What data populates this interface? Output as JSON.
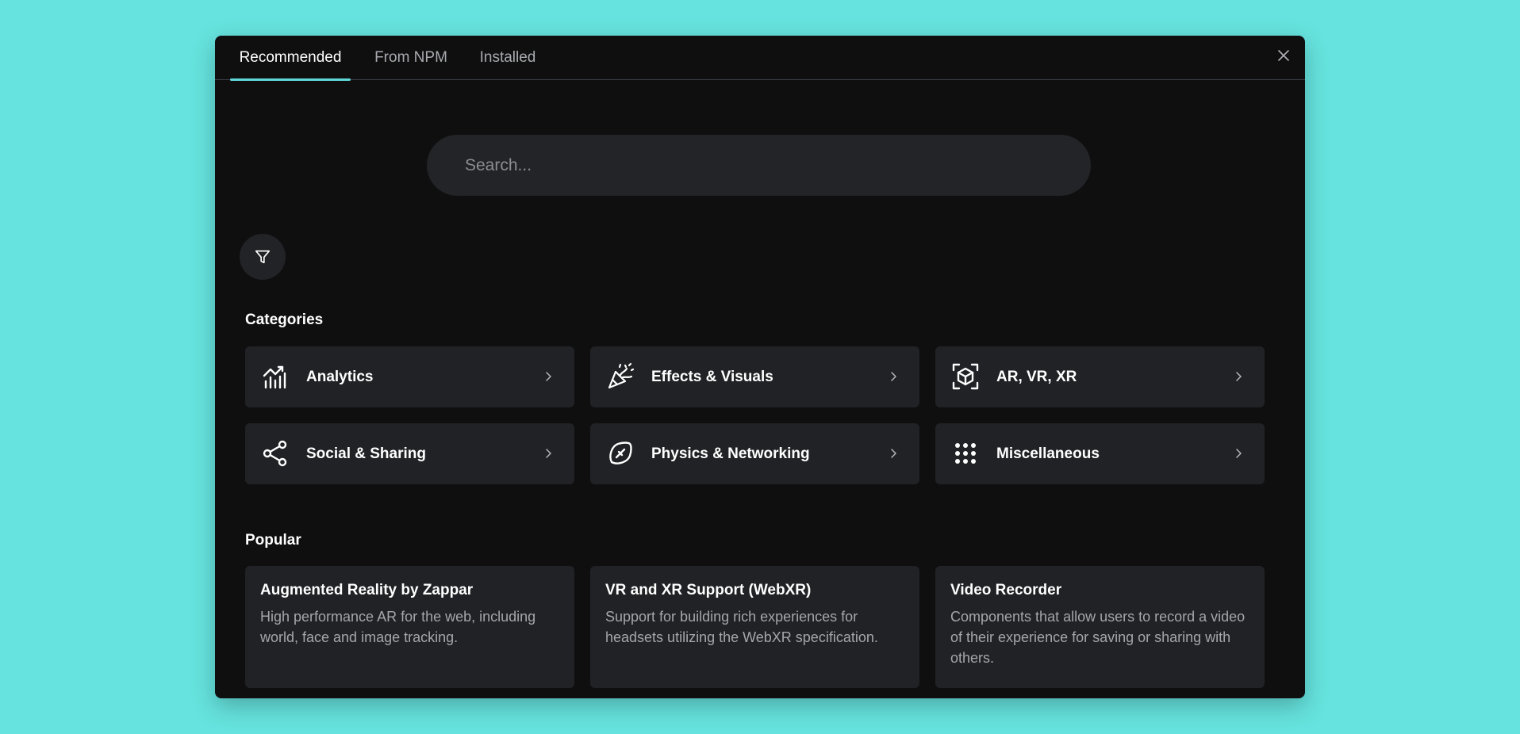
{
  "tabs": [
    {
      "label": "Recommended",
      "active": true
    },
    {
      "label": "From NPM",
      "active": false
    },
    {
      "label": "Installed",
      "active": false
    }
  ],
  "search": {
    "placeholder": "Search..."
  },
  "categories_title": "Categories",
  "categories": [
    {
      "label": "Analytics",
      "icon": "analytics-icon"
    },
    {
      "label": "Effects & Visuals",
      "icon": "party-popper-icon"
    },
    {
      "label": "AR, VR, XR",
      "icon": "ar-cube-icon"
    },
    {
      "label": "Social & Sharing",
      "icon": "share-icon"
    },
    {
      "label": "Physics & Networking",
      "icon": "football-icon"
    },
    {
      "label": "Miscellaneous",
      "icon": "grid-dots-icon"
    }
  ],
  "popular_title": "Popular",
  "popular": [
    {
      "title": "Augmented Reality by Zappar",
      "description": "High performance AR for the web, including world, face and image tracking."
    },
    {
      "title": "VR and XR Support (WebXR)",
      "description": "Support for building rich experiences for headsets utilizing the WebXR specification."
    },
    {
      "title": "Video Recorder",
      "description": "Components that allow users to record a video of their experience for saving or sharing with others."
    }
  ],
  "colors": {
    "background": "#66e3de",
    "modal": "#0f0f10",
    "card": "#212225",
    "accent": "#5fd8d8"
  }
}
